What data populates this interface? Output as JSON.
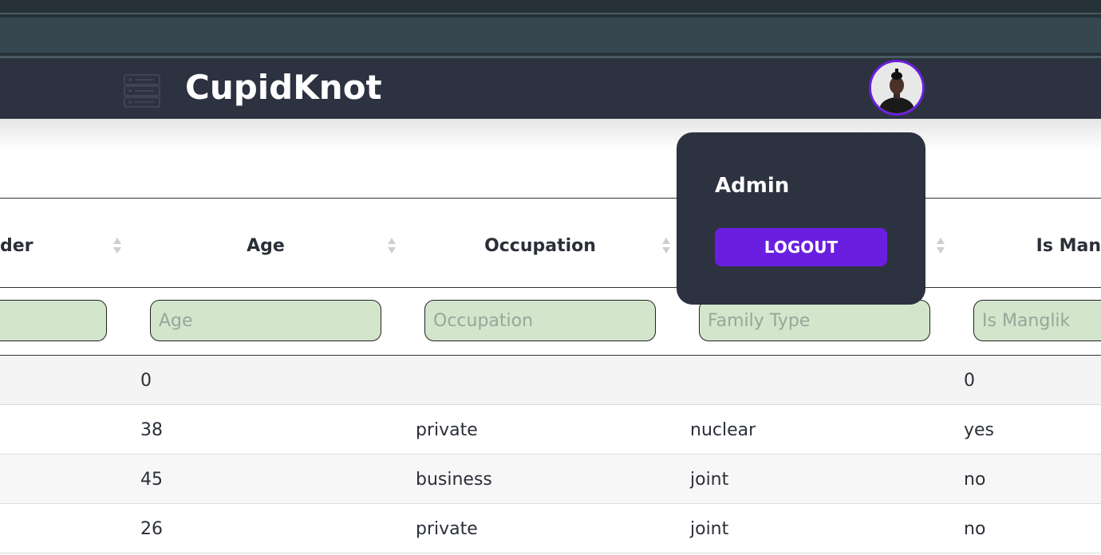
{
  "app": {
    "brand": "CupidKnot"
  },
  "user_menu": {
    "name": "Admin",
    "logout_label": "LOGOUT"
  },
  "table": {
    "columns": [
      {
        "key": "gender",
        "label": "der",
        "placeholder": ""
      },
      {
        "key": "age",
        "label": "Age",
        "placeholder": "Age"
      },
      {
        "key": "occupation",
        "label": "Occupation",
        "placeholder": "Occupation"
      },
      {
        "key": "family_type",
        "label": "",
        "placeholder": "Family Type"
      },
      {
        "key": "is_manglik",
        "label": "Is Man",
        "placeholder": "Is Manglik"
      }
    ],
    "rows": [
      {
        "age": "0",
        "occupation": "",
        "family_type": "",
        "is_manglik": "0"
      },
      {
        "age": "38",
        "occupation": "private",
        "family_type": "nuclear",
        "is_manglik": "yes"
      },
      {
        "age": "45",
        "occupation": "business",
        "family_type": "joint",
        "is_manglik": "no"
      },
      {
        "age": "26",
        "occupation": "private",
        "family_type": "joint",
        "is_manglik": "no"
      }
    ]
  },
  "colors": {
    "navbar": "#2d3240",
    "accent": "#6a1fe0",
    "filter_bg": "#d3e6cc"
  }
}
